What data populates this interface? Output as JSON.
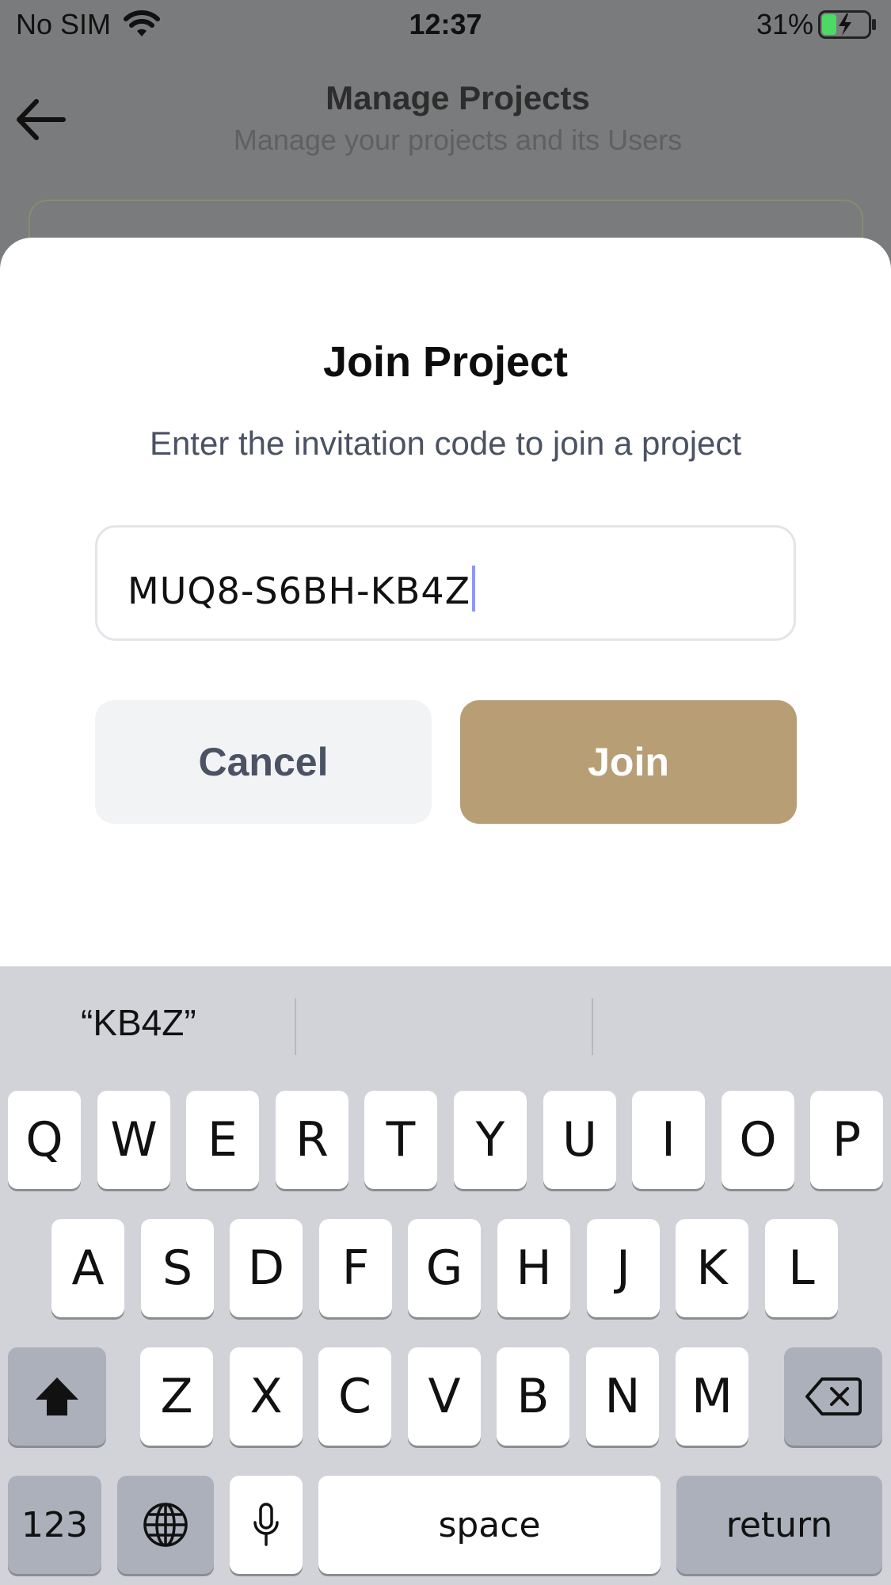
{
  "status_bar": {
    "carrier": "No SIM",
    "time": "12:37",
    "battery_percent": "31%",
    "battery_level": 0.31
  },
  "page": {
    "title": "Manage Projects",
    "subtitle": "Manage your projects and its Users"
  },
  "modal": {
    "title": "Join Project",
    "description": "Enter the invitation code to join a project",
    "code_value": "MUQ8-S6BH-KB4Z",
    "cancel_label": "Cancel",
    "join_label": "Join",
    "accent_color": "#b79e75"
  },
  "keyboard": {
    "suggestion": "“KB4Z”",
    "row1": [
      "Q",
      "W",
      "E",
      "R",
      "T",
      "Y",
      "U",
      "I",
      "O",
      "P"
    ],
    "row2": [
      "A",
      "S",
      "D",
      "F",
      "G",
      "H",
      "J",
      "K",
      "L"
    ],
    "row3": [
      "Z",
      "X",
      "C",
      "V",
      "B",
      "N",
      "M"
    ],
    "numbers_label": "123",
    "space_label": "space",
    "return_label": "return",
    "shift_icon": "shift-icon",
    "delete_icon": "backspace-icon",
    "globe_icon": "globe-icon",
    "mic_icon": "microphone-icon"
  }
}
